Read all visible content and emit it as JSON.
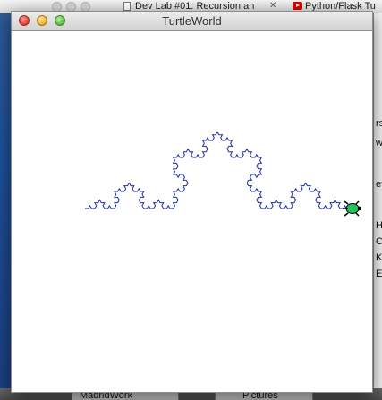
{
  "browser": {
    "tabs": [
      {
        "label": "Dev Lab #01: Recursion an",
        "close": "✕"
      },
      {
        "label": "Python/Flask Tu"
      }
    ]
  },
  "editor_behind": {
    "lines": [
      "rs",
      "w",
      "et",
      "H",
      "C",
      "K",
      "E/"
    ]
  },
  "dock_tabs": [
    "MadridWork",
    "Pictures"
  ],
  "window": {
    "title": "TurtleWorld"
  },
  "turtle": {
    "pen_color": "#1f2fa6",
    "body_color": "#22c25a",
    "shape": "turtle"
  },
  "koch": {
    "depth": 4
  }
}
